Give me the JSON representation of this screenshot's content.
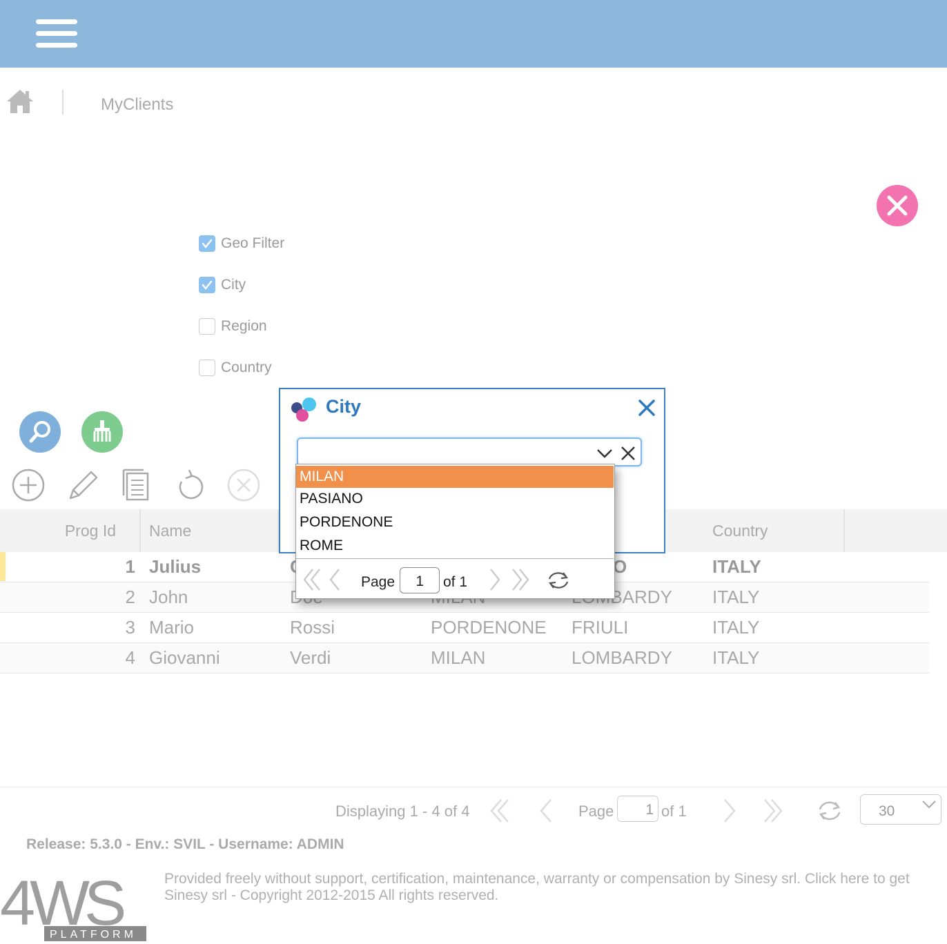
{
  "header": {
    "menu_icon": "hamburger-menu-icon"
  },
  "breadcrumb": {
    "home_icon": "home-icon",
    "current": "MyClients"
  },
  "form": {
    "close_icon": "close-icon",
    "filters": [
      {
        "label": "Geo Filter",
        "checked": true
      },
      {
        "label": "City",
        "checked": true
      },
      {
        "label": "Region",
        "checked": false
      },
      {
        "label": "Country",
        "checked": false
      }
    ],
    "search_icon": "search-icon",
    "clear_icon": "broom-icon"
  },
  "toolbar": [
    "add-icon",
    "edit-icon",
    "copy-icon",
    "reload-icon",
    "delete-icon"
  ],
  "grid": {
    "columns": {
      "prog_id": "Prog Id",
      "name": "Name",
      "country": "Country"
    },
    "rows": [
      {
        "id": "1",
        "name": "Julius",
        "surname": "C",
        "city": "",
        "region": "O",
        "country": "ITALY"
      },
      {
        "id": "2",
        "name": "John",
        "surname": "Doe",
        "city": "MILAN",
        "region": "LOMBARDY",
        "country": "ITALY"
      },
      {
        "id": "3",
        "name": "Mario",
        "surname": "Rossi",
        "city": "PORDENONE",
        "region": "FRIULI",
        "country": "ITALY"
      },
      {
        "id": "4",
        "name": "Giovanni",
        "surname": "Verdi",
        "city": "MILAN",
        "region": "LOMBARDY",
        "country": "ITALY"
      }
    ]
  },
  "pager": {
    "displaying": "Displaying 1 - 4 of 4",
    "page_label": "Page",
    "page_value": "1",
    "of_label": "of 1",
    "page_size": "30"
  },
  "footer": {
    "release": "Release: 5.3.0 - Env.: SVIL - Username: ADMIN",
    "notice_line1": "Provided freely without support, certification, maintenance, warranty or compensation by Sinesy srl. Click here to get",
    "notice_line2": "Sinesy srl - Copyright 2012-2015 All rights reserved.",
    "logo_text": "4WS",
    "logo_sub": "PLATFORM"
  },
  "dialog": {
    "title": "City",
    "input_value": "",
    "options": [
      "MILAN",
      "PASIANO",
      "PORDENONE",
      "ROME"
    ],
    "highlighted": "MILAN",
    "page_label": "Page",
    "page_value": "1",
    "of_label": "of 1"
  },
  "colors": {
    "header": "#8db8dc",
    "accent_blue": "#2e78be",
    "highlight": "#f0904a",
    "close_button": "#f273b0",
    "search_button": "#7fb0dc",
    "clear_button": "#7ecb8e"
  }
}
